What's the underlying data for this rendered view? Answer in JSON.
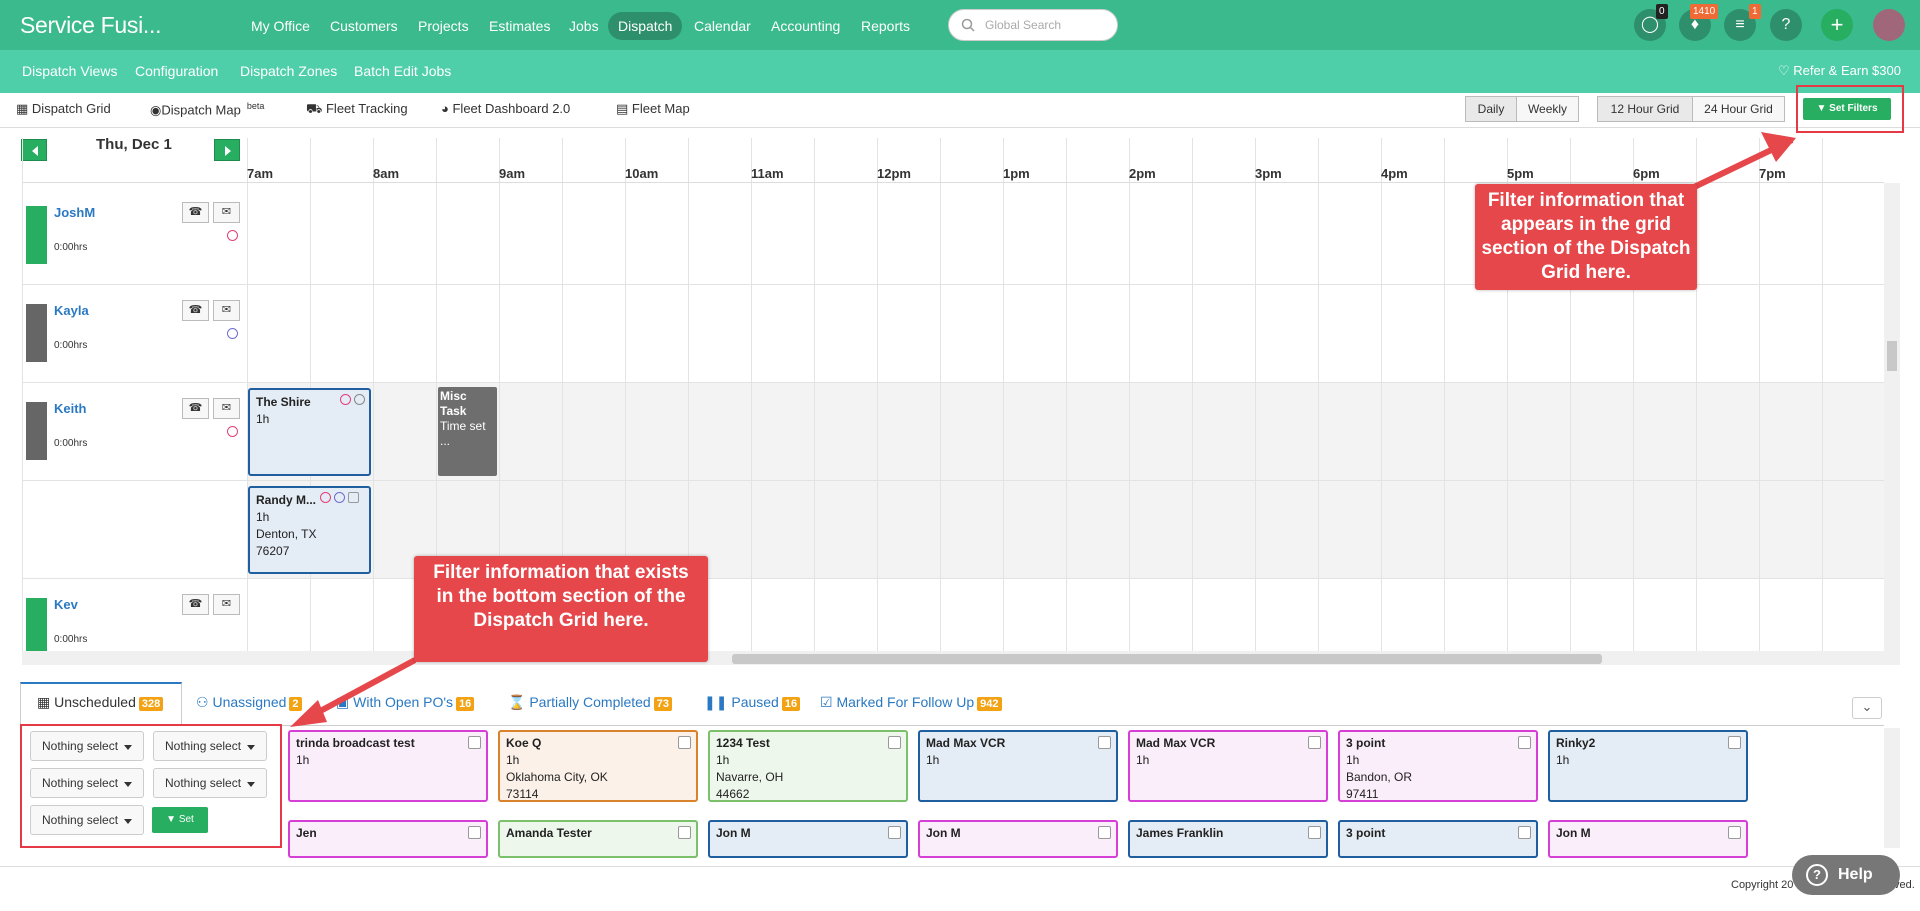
{
  "app": {
    "title": "Service Fusi..."
  },
  "nav": [
    "My Office",
    "Customers",
    "Projects",
    "Estimates",
    "Jobs",
    "Dispatch",
    "Calendar",
    "Accounting",
    "Reports"
  ],
  "active_nav": "Dispatch",
  "search": {
    "placeholder": "Global Search"
  },
  "header_badges": {
    "chat": "0",
    "notifications": "1410",
    "tasks": "1"
  },
  "subnav": [
    "Dispatch Views",
    "Configuration",
    "Dispatch Zones",
    "Batch Edit Jobs"
  ],
  "refer": "Refer & Earn $300",
  "view_tabs": {
    "grid": "Dispatch Grid",
    "map": "Dispatch Map",
    "map_sup": "beta",
    "fleet": "Fleet Tracking",
    "dashboard": "Fleet Dashboard 2.0",
    "fleet_map": "Fleet Map"
  },
  "range": {
    "daily": "Daily",
    "weekly": "Weekly"
  },
  "grid_mode": {
    "h12": "12 Hour Grid",
    "h24": "24 Hour Grid"
  },
  "set_filters": "Set Filters",
  "date": "Thu, Dec 1",
  "hours": [
    "7am",
    "8am",
    "9am",
    "10am",
    "11am",
    "12pm",
    "1pm",
    "2pm",
    "3pm",
    "4pm",
    "5pm",
    "6pm",
    "7pm"
  ],
  "techs": [
    {
      "name": "JoshM",
      "hrs": "0:00hrs"
    },
    {
      "name": "Kayla",
      "hrs": "0:00hrs"
    },
    {
      "name": "Keith",
      "hrs": "0:00hrs"
    },
    {
      "name": "Kev",
      "hrs": "0:00hrs"
    }
  ],
  "grid_jobs": {
    "shire": {
      "title": "The Shire",
      "dur": "1h"
    },
    "misc": {
      "title": "Misc Task",
      "sub": "Time set ..."
    },
    "randy": {
      "title": "Randy M...",
      "dur": "1h",
      "city": "Denton, TX",
      "zip": "76207"
    }
  },
  "bottom_tabs": [
    {
      "label": "Unscheduled",
      "count": "328"
    },
    {
      "label": "Unassigned",
      "count": "2"
    },
    {
      "label": "With Open PO's",
      "count": "16"
    },
    {
      "label": "Partially Completed",
      "count": "73"
    },
    {
      "label": "Paused",
      "count": "16"
    },
    {
      "label": "Marked For Follow Up",
      "count": "942"
    }
  ],
  "filter_dropdowns": [
    "Nothing select",
    "Nothing select",
    "Nothing select",
    "Nothing select",
    "Nothing select"
  ],
  "set_label": "Set",
  "unscheduled_cards": [
    {
      "title": "trinda broadcast test",
      "l1": "1h",
      "l2": "",
      "l3": "",
      "color": "#d63fd6",
      "bg": "#fbeefb"
    },
    {
      "title": "Koe Q",
      "l1": "1h",
      "l2": "Oklahoma City, OK",
      "l3": "73114",
      "color": "#d9822b",
      "bg": "#fbf1e8"
    },
    {
      "title": "1234 Test",
      "l1": "1h",
      "l2": "Navarre, OH",
      "l3": "44662",
      "color": "#7bc06b",
      "bg": "#eef7ec"
    },
    {
      "title": "Mad Max VCR",
      "l1": "1h",
      "l2": "",
      "l3": "",
      "color": "#1f5fa0",
      "bg": "#e4ecf5"
    },
    {
      "title": "Mad Max VCR",
      "l1": "1h",
      "l2": "",
      "l3": "",
      "color": "#d63fd6",
      "bg": "#fbeefb"
    },
    {
      "title": "3 point",
      "l1": "1h",
      "l2": "Bandon, OR",
      "l3": "97411",
      "color": "#d63fd6",
      "bg": "#fbeefb"
    },
    {
      "title": "Rinky2",
      "l1": "1h",
      "l2": "",
      "l3": "",
      "color": "#1f5fa0",
      "bg": "#e4ecf5"
    },
    {
      "title": "Jen",
      "l1": "",
      "l2": "",
      "l3": "",
      "color": "#d63fd6",
      "bg": "#fbeefb"
    },
    {
      "title": "Amanda Tester",
      "l1": "",
      "l2": "",
      "l3": "",
      "color": "#7bc06b",
      "bg": "#eef7ec"
    },
    {
      "title": "Jon M",
      "l1": "",
      "l2": "",
      "l3": "",
      "color": "#1f5fa0",
      "bg": "#e4ecf5"
    },
    {
      "title": "Jon M",
      "l1": "",
      "l2": "",
      "l3": "",
      "color": "#d63fd6",
      "bg": "#fbeefb"
    },
    {
      "title": "James Franklin",
      "l1": "",
      "l2": "",
      "l3": "",
      "color": "#1f5fa0",
      "bg": "#e4ecf5"
    },
    {
      "title": "3 point",
      "l1": "",
      "l2": "",
      "l3": "",
      "color": "#1f5fa0",
      "bg": "#e4ecf5"
    },
    {
      "title": "Jon M",
      "l1": "",
      "l2": "",
      "l3": "",
      "color": "#d63fd6",
      "bg": "#fbeefb"
    }
  ],
  "callouts": {
    "top": "Filter information that appears in the grid section of the Dispatch Grid here.",
    "bottom": "Filter information that exists in the bottom section of the Dispatch Grid here."
  },
  "footer": {
    "copyright": "Copyright 20",
    "suffix": "ved.",
    "help": "Help"
  },
  "colors": {
    "brand": "#3bba8e",
    "subbar": "#4fcfa9",
    "accent_green": "#27ae60",
    "callout_red": "#e5474b",
    "badge_orange": "#f2a213"
  }
}
